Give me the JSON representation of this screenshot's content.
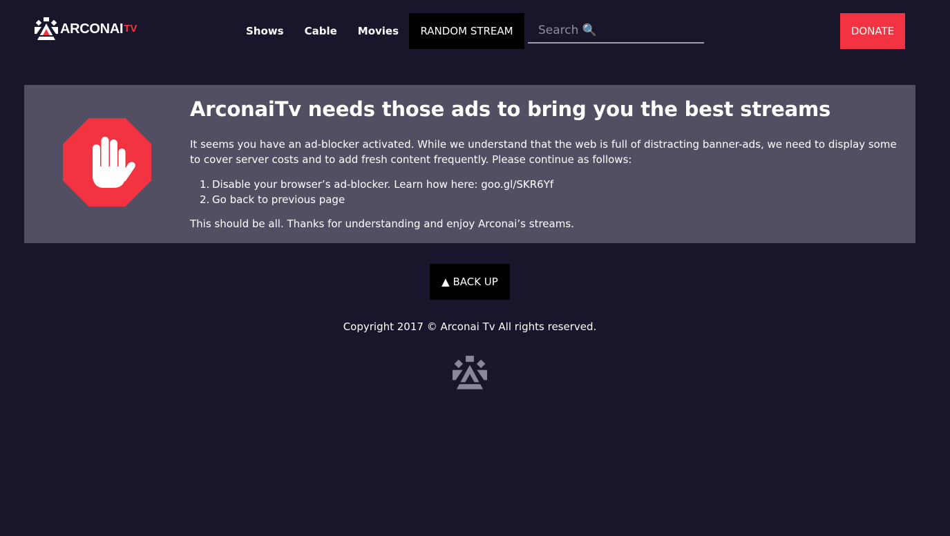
{
  "brand": {
    "name": "ARCONAI",
    "suffix": "TV"
  },
  "nav": {
    "shows": "Shows",
    "cable": "Cable",
    "movies": "Movies",
    "random": "RANDOM STREAM"
  },
  "search": {
    "placeholder": "Search 🔍",
    "value": ""
  },
  "donate": "DONATE",
  "notice": {
    "title": "ArconaiTv needs those ads to bring you the best streams",
    "body": "It seems you have an ad-blocker activated. While we understand that the web is full of distracting banner-ads, we need to display some to cover server costs and to add fresh content frequently. Please continue as follows:",
    "steps": [
      {
        "num": "1.",
        "text": "Disable your browser’s ad-blocker. Learn how here: goo.gl/SKR6Yf"
      },
      {
        "num": "2.",
        "text": "Go back to previous page"
      }
    ],
    "footer": "This should be all. Thanks for understanding and enjoy Arconai’s streams."
  },
  "back_up": "▲ BACK UP",
  "copyright": "Copyright 2017 © Arconai Tv All rights reserved.",
  "colors": {
    "background": "#19162c",
    "panel": "#524f63",
    "accent": "#f23341",
    "button_dark": "#000000"
  },
  "icons": {
    "logo": "arconai-logo-icon",
    "stop": "stop-hand-icon",
    "footer_logo": "arconai-logo-icon"
  }
}
